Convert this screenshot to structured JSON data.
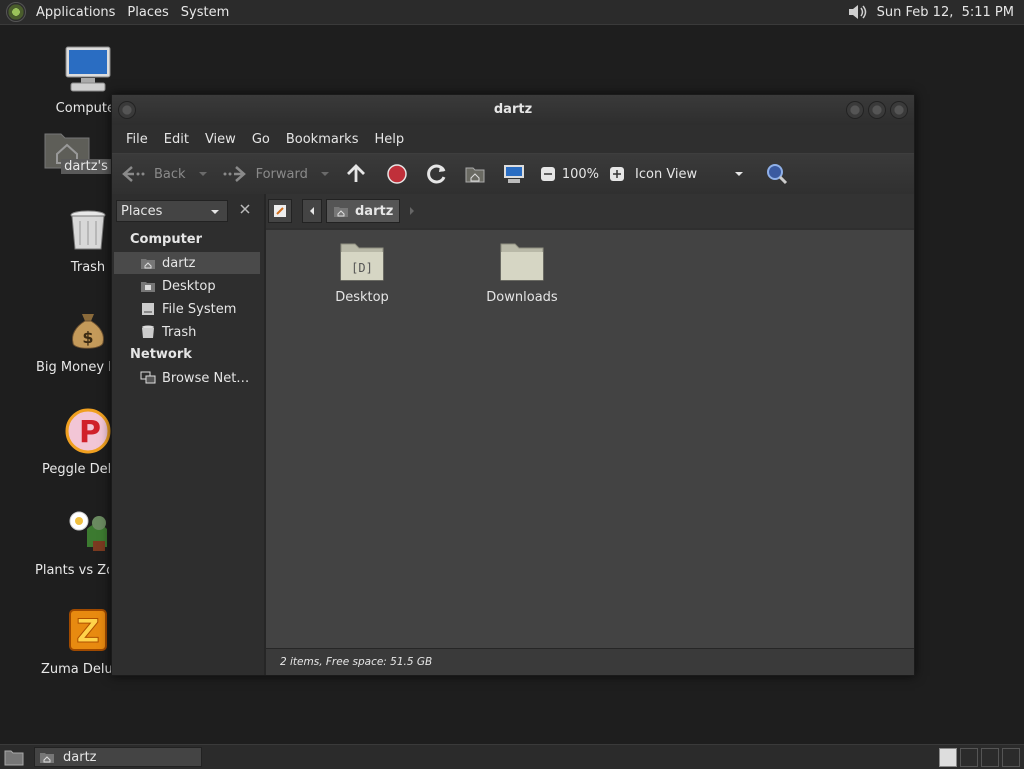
{
  "top_panel": {
    "menus": [
      "Applications",
      "Places",
      "System"
    ],
    "clock": "Sun Feb 12,  5:11 PM"
  },
  "desktop_icons": [
    {
      "label": "Computer",
      "icon": "computer-icon"
    },
    {
      "label": "dartz's Home",
      "icon": "home-folder-icon"
    },
    {
      "label": "Trash",
      "icon": "trash-icon"
    },
    {
      "label": "Big Money Deluxe",
      "icon": "money-bag-icon"
    },
    {
      "label": "Peggle Deluxe",
      "icon": "peggle-icon"
    },
    {
      "label": "Plants vs Zombies",
      "icon": "plants-vs-zombies-icon"
    },
    {
      "label": "Zuma Deluxe",
      "icon": "zuma-icon"
    }
  ],
  "window": {
    "title": "dartz",
    "menubar": [
      "File",
      "Edit",
      "View",
      "Go",
      "Bookmarks",
      "Help"
    ],
    "toolbar": {
      "back": "Back",
      "forward": "Forward",
      "zoom": "100%",
      "view_mode": "Icon View"
    },
    "side_pane": {
      "selector": "Places",
      "sections": [
        {
          "heading": "Computer",
          "items": [
            {
              "label": "dartz",
              "icon": "home-icon",
              "selected": true
            },
            {
              "label": "Desktop",
              "icon": "desktop-icon",
              "selected": false
            },
            {
              "label": "File System",
              "icon": "drive-icon",
              "selected": false
            },
            {
              "label": "Trash",
              "icon": "trash-icon",
              "selected": false
            }
          ]
        },
        {
          "heading": "Network",
          "items": [
            {
              "label": "Browse Net…",
              "icon": "network-icon",
              "selected": false
            }
          ]
        }
      ]
    },
    "path": {
      "current": "dartz"
    },
    "files": [
      {
        "name": "Desktop",
        "icon": "desktop-folder-icon"
      },
      {
        "name": "Downloads",
        "icon": "folder-icon"
      }
    ],
    "status": "2 items, Free space: 51.5 GB"
  },
  "bottom_panel": {
    "task": "dartz"
  }
}
